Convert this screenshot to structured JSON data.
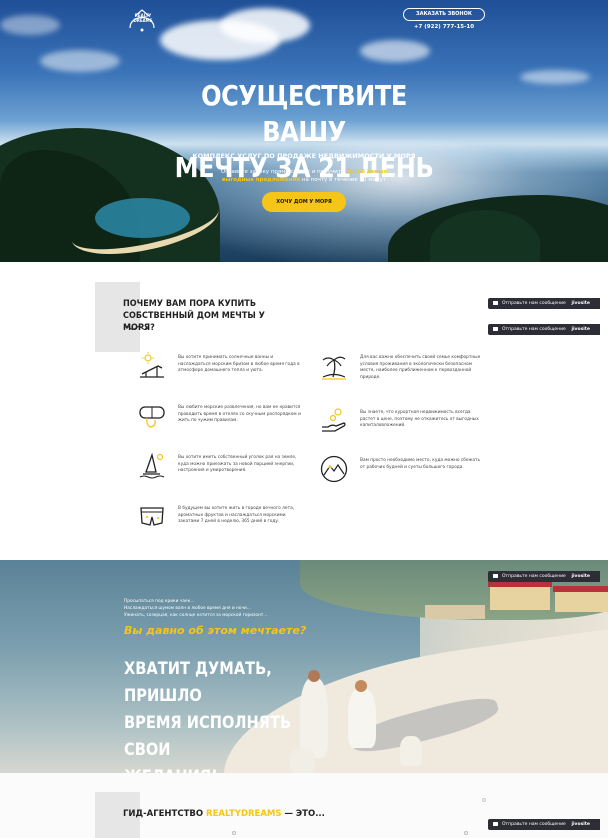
{
  "header": {
    "logo_text": "REALTY DREAMS",
    "call_button": "ЗАКАЗАТЬ ЗВОНОК",
    "phone": "+7 (922) 777-15-10"
  },
  "hero": {
    "title_line1": "ОСУЩЕСТВИТЕ ВАШУ",
    "title_line2": "МЕЧТУ ЗА 21 ДЕНЬ",
    "subtitle": "КОМПЛЕКС УСЛУГ ПО ПРОДАЖЕ НЕДВИЖИМОСТИ У МОРЯ",
    "desc_part1": "Оставьте заявку прямо сейчас и получите ",
    "desc_highlight": "ТОП-5 самых выгодных предложений",
    "desc_part2": " на почту в течение 10 минут",
    "cta_button": "ХОЧУ ДОМ У МОРЯ"
  },
  "why": {
    "title": "ПОЧЕМУ ВАМ ПОРА КУПИТЬ СОБСТВЕННЫЙ ДОМ МЕЧТЫ У МОРЯ?",
    "features": [
      {
        "icon": "sunbed-icon",
        "text": "Вы хотите принимать солнечные ванны и наслаждаться морским бризом в любое время года в атмосфере домашнего тепла и уюта."
      },
      {
        "icon": "palm-island-icon",
        "text": "Для вас важно обеспечить своей семье комфортные условия проживания в экологически безопасном месте, наиболее приближенном к первозданной природе."
      },
      {
        "icon": "diving-mask-icon",
        "text": "Вы любите морские развлечения, но вам не нравится проводить время в отелях со скучным распорядком и жить по чужим правилам."
      },
      {
        "icon": "hand-coins-icon",
        "text": "Вы знаете, что курортная недвижимость всегда растет в цене, поэтому не откажитесь от выгодных капиталовложений."
      },
      {
        "icon": "windsurf-icon",
        "text": "Вы хотите иметь собственный уголок рая на земле, куда можно приезжать за новой порцией энергии, настроения и умиротворения."
      },
      {
        "icon": "mountains-icon",
        "text": "Вам просто необходимо место, куда можно сбежать от рабочих будней и суеты большого города."
      },
      {
        "icon": "swim-shorts-icon",
        "text": "В будущем вы хотите жить в городе вечного лета, ароматных фруктов и наслаждаться морскими закатами 7 дней в неделю, 365 дней в году."
      }
    ]
  },
  "chat_widget": {
    "label": "Отправьте нам сообщение",
    "brand": "jivosite"
  },
  "dream": {
    "line1": "Просыпаться под крики чаек...",
    "line2": "Наслаждаться шумом волн в любое время дня и ночи...",
    "line3": "Ужинать, созерцая, как солнце катится за морской горизонт...",
    "question": "Вы давно об этом мечтаете?",
    "headline_line1": "ХВАТИТ ДУМАТЬ, ПРИШЛО",
    "headline_line2": "ВРЕМЯ ИСПОЛНЯТЬ СВОИ",
    "headline_line3": "ЖЕЛАНИЯ!"
  },
  "agency": {
    "title_prefix": "ГИД-АГЕНТСТВО ",
    "title_brand": "REALTYDREAMS",
    "title_suffix": " — ЭТО..."
  },
  "colors": {
    "accent": "#f5c518",
    "dark": "#222222",
    "chat_bg": "#2d2d36"
  }
}
